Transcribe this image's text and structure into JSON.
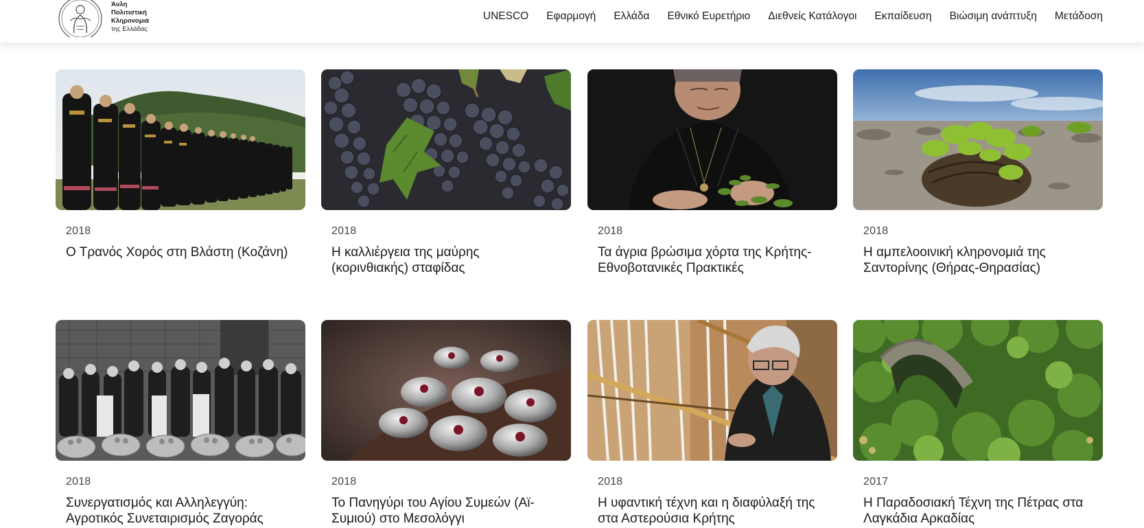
{
  "header": {
    "logo": {
      "line1": "Άυλη",
      "line2": "Πολιτιστική",
      "line3": "Κληρονομιά",
      "line4": "της Ελλάδας"
    },
    "nav": [
      {
        "label": "UNESCO"
      },
      {
        "label": "Εφαρμογή"
      },
      {
        "label": "Ελλάδα"
      },
      {
        "label": "Εθνικό Ευρετήριο"
      },
      {
        "label": "Διεθνείς Κατάλογοι"
      },
      {
        "label": "Εκπαίδευση"
      },
      {
        "label": "Βιώσιμη ανάπτυξη"
      },
      {
        "label": "Μετάδοση"
      }
    ]
  },
  "cards": [
    {
      "year": "2018",
      "title": "Ο Τρανός Χορός στη Βλάστη (Κοζάνη)",
      "image": "women in traditional costume dancing outdoors"
    },
    {
      "year": "2018",
      "title": "Η καλλιέργεια της μαύρης (κορινθιακής) σταφίδας",
      "image": "black grape clusters with leaves"
    },
    {
      "year": "2018",
      "title": "Τα άγρια βρώσιμα χόρτα της Κρήτης- Εθνοβοτανικές Πρακτικές",
      "image": "elderly woman cleaning wild greens"
    },
    {
      "year": "2018",
      "title": "Η αμπελοοινική κληρονομιά της Σαντορίνης (Θήρας-Θηρασίας)",
      "image": "basket-shaped vine on volcanic soil"
    },
    {
      "year": "2018",
      "title": "Συνεργατισμός και Αλληλεγγύη: Αγροτικός Συνεταιρισμός Ζαγοράς Πηλίου",
      "image": "black and white group photo with baskets"
    },
    {
      "year": "2018",
      "title": "Το Πανηγύρι του Αγίου Συμεών (Αϊ-Συμιού) στο Μεσολόγγι",
      "image": "silver ornament with red stones"
    },
    {
      "year": "2018",
      "title": "Η υφαντική τέχνη και η διαφύλαξή της στα Αστερούσια Κρήτης",
      "image": "elderly woman weaving at a loom"
    },
    {
      "year": "2017",
      "title": "Η Παραδοσιακή Τέχνη της Πέτρας στα Λαγκάδια Αρκαδίας",
      "image": "stone arch bridge in green forest"
    }
  ]
}
